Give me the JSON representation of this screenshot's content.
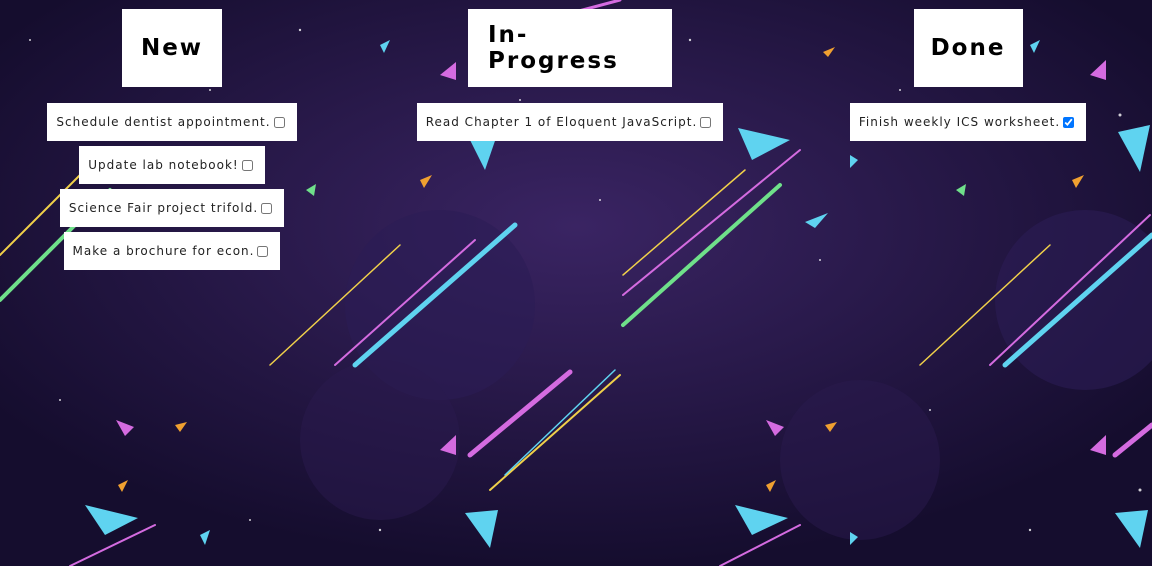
{
  "columns": [
    {
      "title": "New",
      "tasks": [
        {
          "text": "Schedule dentist appointment.",
          "checked": false
        },
        {
          "text": "Update lab notebook!",
          "checked": false
        },
        {
          "text": "Science Fair project trifold.",
          "checked": false
        },
        {
          "text": "Make a brochure for econ.",
          "checked": false
        }
      ]
    },
    {
      "title": "In-Progress",
      "tasks": [
        {
          "text": "Read Chapter 1 of Eloquent JavaScript.",
          "checked": false
        }
      ]
    },
    {
      "title": "Done",
      "tasks": [
        {
          "text": "Finish weekly ICS worksheet.",
          "checked": true
        }
      ]
    }
  ],
  "colors": {
    "background": "#1a1035",
    "stripe_cyan": "#5fd3f0",
    "stripe_magenta": "#d46be0",
    "stripe_yellow": "#f0d04a",
    "stripe_green": "#6fe08a"
  }
}
